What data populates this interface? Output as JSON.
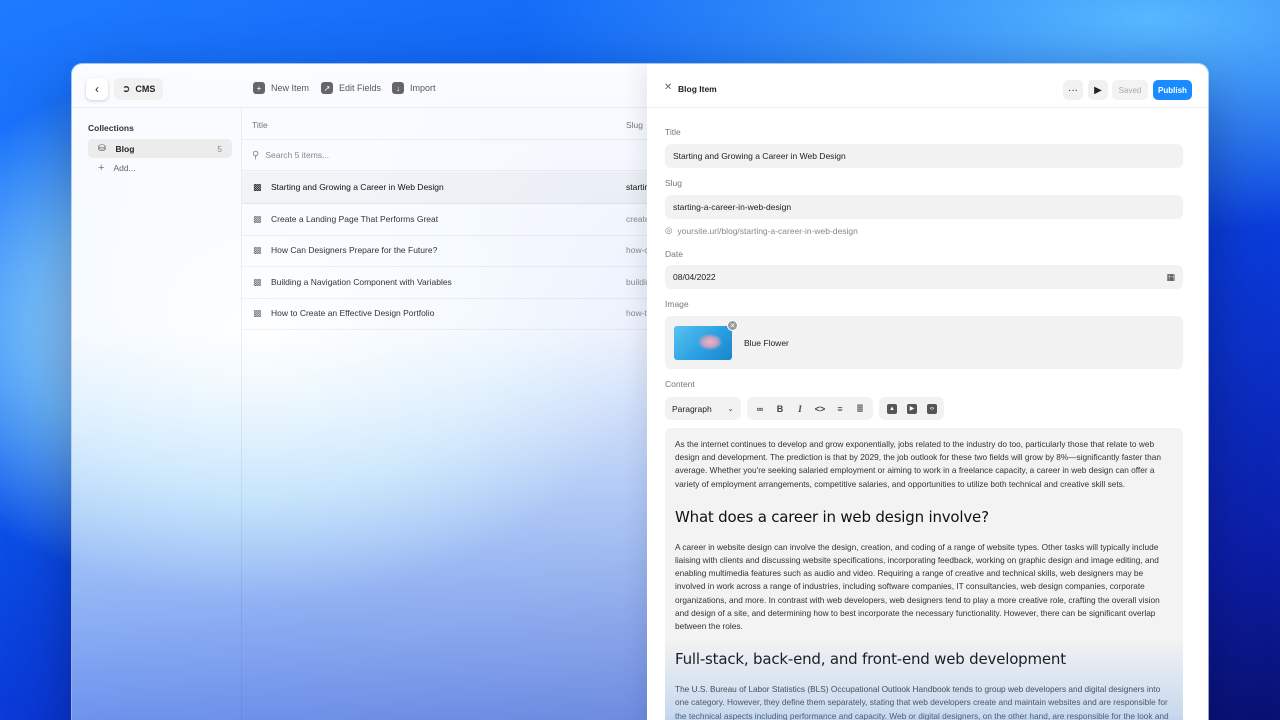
{
  "topbar": {
    "back_icon": "chevron-left-icon",
    "app_label": "CMS",
    "new_item": "New Item",
    "edit_fields": "Edit Fields",
    "import": "Import"
  },
  "sidebar": {
    "heading": "Collections",
    "collection": {
      "label": "Blog",
      "count": "5"
    },
    "add_label": "Add..."
  },
  "table": {
    "col_title": "Title",
    "col_slug": "Slug",
    "search_placeholder": "Search 5 items...",
    "rows": [
      {
        "title": "Starting and Growing a Career in Web Design",
        "slug": "starting-a-career-in-web-design"
      },
      {
        "title": "Create a Landing Page That Performs Great",
        "slug": "create-a-landing-page"
      },
      {
        "title": "How Can Designers Prepare for the Future?",
        "slug": "how-can-designers-prepare"
      },
      {
        "title": "Building a Navigation Component with Variables",
        "slug": "building-a-navigation-component"
      },
      {
        "title": "How to Create an Effective Design Portfolio",
        "slug": "how-to-create-a-portfolio"
      }
    ]
  },
  "editor": {
    "header_title": "Blog Item",
    "saved": "Saved",
    "publish": "Publish",
    "publish_color": "#1a8cff",
    "fields": {
      "title_label": "Title",
      "title_value": "Starting and Growing a Career in Web Design",
      "slug_label": "Slug",
      "slug_value": "starting-a-career-in-web-design",
      "url_hint": "yoursite.url/blog/starting-a-career-in-web-design",
      "date_label": "Date",
      "date_value": "08/04/2022",
      "image_label": "Image",
      "image_name": "Blue Flower",
      "content_label": "Content"
    },
    "toolbar": {
      "paragraph": "Paragraph",
      "bold": "B",
      "italic": "I",
      "code": "<>"
    },
    "content": {
      "p1": "As the internet continues to develop and grow exponentially, jobs related to the industry do too, particularly those that relate to web design and development. The prediction is that by 2029, the job outlook for these two fields will grow by 8%—significantly faster than average. Whether you're seeking salaried employment or aiming to work in a freelance capacity, a career in web design can offer a variety of employment arrangements, competitive salaries, and opportunities to utilize both technical and creative skill sets.",
      "h1": "What does a career in web design involve?",
      "p2": "A career in website design can involve the design, creation, and coding of a range of website types. Other tasks will typically include liaising with clients and discussing website specifications, incorporating feedback, working on graphic design and image editing, and enabling multimedia features such as audio and video.  Requiring a range of creative and technical skills, web designers may be involved in work across a range of industries, including software companies, IT consultancies, web design companies, corporate organizations, and more. In contrast with web developers, web designers tend to play a more creative role, crafting the overall vision and design of a site, and determining how to best incorporate the necessary functionality. However, there can be significant overlap between the roles.",
      "h2": "Full-stack, back-end, and front-end web development",
      "p3": "The U.S. Bureau of Labor Statistics (BLS) Occupational Outlook Handbook tends to group web developers and digital designers into one category. However, they define them separately, stating that web developers create and maintain websites and are responsible for the technical aspects including performance and capacity.  Web or digital designers, on the other hand, are responsible for the look and functionality of websites and interfaces."
    }
  }
}
